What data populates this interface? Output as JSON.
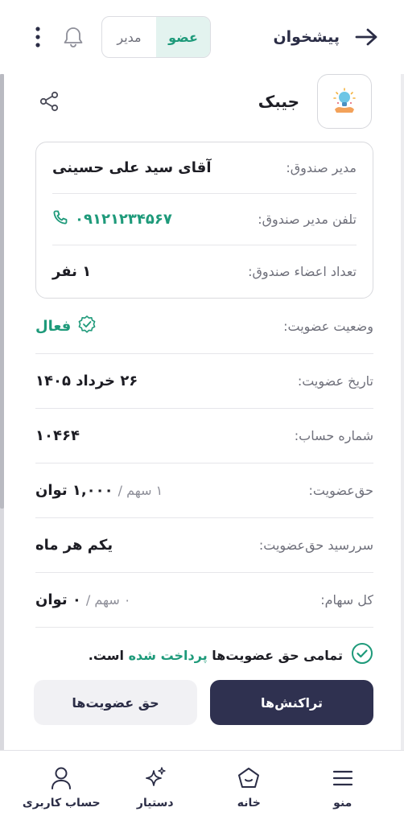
{
  "header": {
    "title": "پیشخوان",
    "roles": {
      "manager": "مدیر",
      "member": "عضو",
      "active": "member"
    }
  },
  "fund": {
    "name": "جیبک"
  },
  "manager_card": {
    "manager_label": "مدیر صندوق:",
    "manager_value": "آقای سید علی حسینی",
    "phone_label": "تلفن مدیر صندوق:",
    "phone_value": "۰۹۱۲۱۲۳۴۵۶۷",
    "members_label": "تعداد اعضاء صندوق:",
    "members_value": "۱ نفر"
  },
  "details": {
    "status_label": "وضعیت عضویت:",
    "status_value": "فعال",
    "date_label": "تاریخ عضویت:",
    "date_value": "۲۶ خرداد ۱۴۰۵",
    "account_label": "شماره حساب:",
    "account_value": "۱۰۴۶۴",
    "fee_label": "حق‌عضویت:",
    "fee_shares": "۱ سهم /",
    "fee_amount": "۱,۰۰۰ توان",
    "due_label": "سررسید حق‌عضویت:",
    "due_value": "یکم هر ماه",
    "shares_label": "کل سهام:",
    "shares_count": "۰ سهم /",
    "shares_amount": "۰ توان"
  },
  "paid_note": {
    "prefix": "تمامی حق عضویت‌ها",
    "highlight": "پرداخت شده",
    "suffix": "است."
  },
  "actions": {
    "transactions": "تراکنش‌ها",
    "fees": "حق عضویت‌ها"
  },
  "nav": {
    "menu": "منو",
    "home": "خانه",
    "assistant": "دستیار",
    "account": "حساب کاربری"
  },
  "colors": {
    "accent": "#1e9a7a",
    "primary": "#2f3150"
  }
}
